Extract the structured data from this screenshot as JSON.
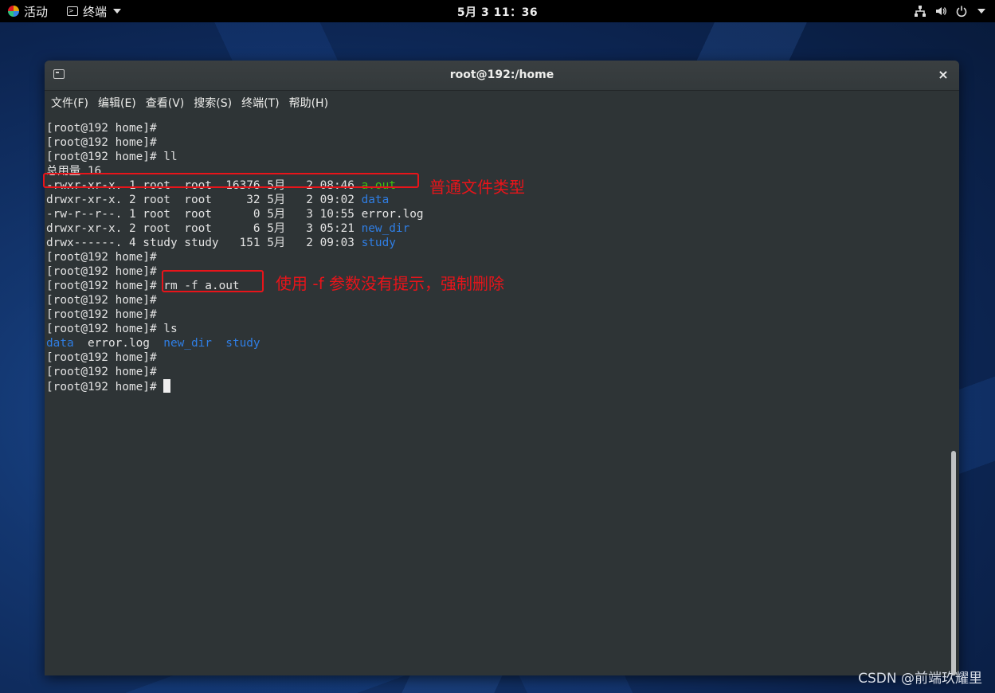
{
  "topbar": {
    "activities_label": "活动",
    "app_menu_label": "终端",
    "clock": "5月 3  11：36"
  },
  "window": {
    "title": "root@192:/home",
    "close_glyph": "×",
    "menu": [
      "文件(F)",
      "编辑(E)",
      "查看(V)",
      "搜索(S)",
      "终端(T)",
      "帮助(H)"
    ]
  },
  "terminal": {
    "lines": [
      {
        "segments": [
          {
            "text": "[root@192 home]#",
            "color": "default"
          }
        ]
      },
      {
        "segments": [
          {
            "text": "[root@192 home]#",
            "color": "default"
          }
        ]
      },
      {
        "segments": [
          {
            "text": "[root@192 home]# ll",
            "color": "default"
          }
        ]
      },
      {
        "segments": [
          {
            "text": "总用量 16",
            "color": "default"
          }
        ]
      },
      {
        "segments": [
          {
            "text": "-rwxr-xr-x. 1 root  root  16376 5月   2 08:46 ",
            "color": "default"
          },
          {
            "text": "a.out",
            "color": "green"
          }
        ]
      },
      {
        "segments": [
          {
            "text": "drwxr-xr-x. 2 root  root     32 5月   2 09:02 ",
            "color": "default"
          },
          {
            "text": "data",
            "color": "blue"
          }
        ]
      },
      {
        "segments": [
          {
            "text": "-rw-r--r--. 1 root  root      0 5月   3 10:55 error.log",
            "color": "default"
          }
        ]
      },
      {
        "segments": [
          {
            "text": "drwxr-xr-x. 2 root  root      6 5月   3 05:21 ",
            "color": "default"
          },
          {
            "text": "new_dir",
            "color": "blue"
          }
        ]
      },
      {
        "segments": [
          {
            "text": "drwx------. 4 study study   151 5月   2 09:03 ",
            "color": "default"
          },
          {
            "text": "study",
            "color": "blue"
          }
        ]
      },
      {
        "segments": [
          {
            "text": "[root@192 home]#",
            "color": "default"
          }
        ]
      },
      {
        "segments": [
          {
            "text": "[root@192 home]#",
            "color": "default"
          }
        ]
      },
      {
        "segments": [
          {
            "text": "[root@192 home]# rm -f a.out",
            "color": "default"
          }
        ]
      },
      {
        "segments": [
          {
            "text": "[root@192 home]#",
            "color": "default"
          }
        ]
      },
      {
        "segments": [
          {
            "text": "[root@192 home]#",
            "color": "default"
          }
        ]
      },
      {
        "segments": [
          {
            "text": "[root@192 home]# ls",
            "color": "default"
          }
        ]
      },
      {
        "segments": [
          {
            "text": "data",
            "color": "blue"
          },
          {
            "text": "  error.log  ",
            "color": "default"
          },
          {
            "text": "new_dir",
            "color": "blue"
          },
          {
            "text": "  ",
            "color": "default"
          },
          {
            "text": "study",
            "color": "blue"
          }
        ]
      },
      {
        "segments": [
          {
            "text": "[root@192 home]#",
            "color": "default"
          }
        ]
      },
      {
        "segments": [
          {
            "text": "[root@192 home]#",
            "color": "default"
          }
        ]
      },
      {
        "segments": [
          {
            "text": "[root@192 home]# ",
            "color": "default"
          }
        ],
        "cursor": true
      }
    ]
  },
  "annotations": {
    "file_type_note": "普通文件类型",
    "force_remove_note": "使用 -f 参数没有提示，强制删除"
  },
  "watermark": "CSDN @前端玖耀里",
  "colors": {
    "accent_red": "#e8141a",
    "ls_green": "#3fc20e",
    "ls_blue": "#2f7ee4",
    "terminal_bg": "#2e3436"
  }
}
